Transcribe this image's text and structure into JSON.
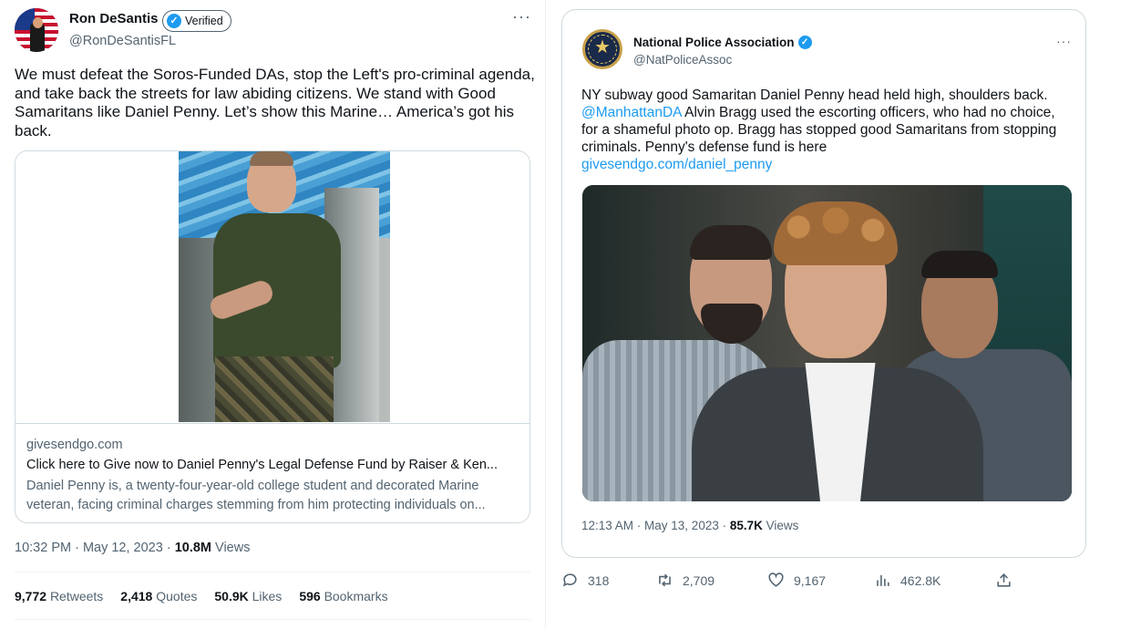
{
  "left_tweet": {
    "author_name": "Ron DeSantis",
    "verified_label": "Verified",
    "handle": "@RonDeSantisFL",
    "text": "We must defeat the Soros-Funded DAs, stop the Left's pro-criminal agenda, and take back the streets for law abiding citizens. We stand with Good Samaritans like Daniel Penny. Let’s show this Marine… America’s got his back.",
    "card": {
      "domain": "givesendgo.com",
      "title": "Click here to Give now to Daniel Penny's Legal Defense Fund by Raiser & Ken...",
      "description": "Daniel Penny is, a twenty-four-year-old college student and decorated Marine veteran, facing criminal charges stemming from him protecting individuals on..."
    },
    "time": "10:32 PM · May 12, 2023 · ",
    "views_count": "10.8M",
    "views_label": "Views",
    "stats": {
      "retweets_count": "9,772",
      "retweets_label": "Retweets",
      "quotes_count": "2,418",
      "quotes_label": "Quotes",
      "likes_count": "50.9K",
      "likes_label": "Likes",
      "bookmarks_count": "596",
      "bookmarks_label": "Bookmarks"
    }
  },
  "right_tweet": {
    "author_name": "National Police Association",
    "handle": "@NatPoliceAssoc",
    "text_part1": "NY subway good Samaritan Daniel Penny head held high, shoulders back. ",
    "mention": "@ManhattanDA",
    "text_part2": " Alvin Bragg used the escorting officers, who had no choice, for a shameful photo op. Bragg has stopped good Samaritans from stopping criminals. Penny's defense fund is here",
    "link": "givesendgo.com/daniel_penny",
    "time": "12:13 AM · May 13, 2023 · ",
    "views_count": "85.7K",
    "views_label": "Views",
    "actions": {
      "replies": "318",
      "retweets": "2,709",
      "likes": "9,167",
      "views": "462.8K"
    }
  },
  "colors": {
    "accent": "#1d9bf0",
    "secondary_text": "#536471",
    "border": "#cfd9de"
  }
}
